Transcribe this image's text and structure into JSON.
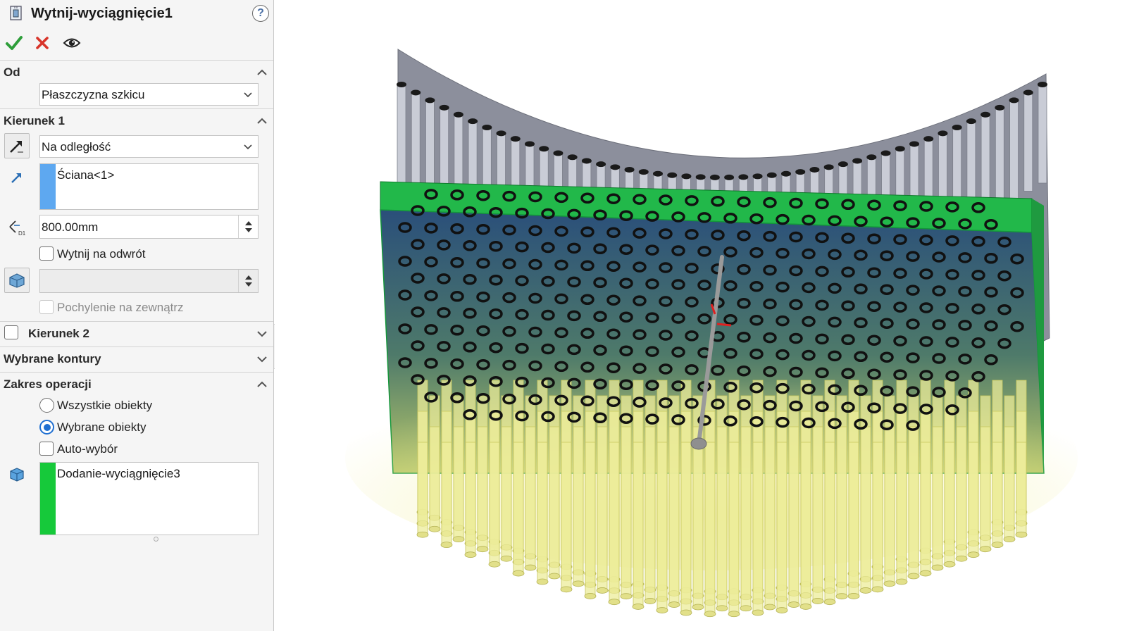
{
  "panel": {
    "title": "Wytnij-wyciągnięcie1",
    "help_label": "?",
    "actions": {
      "ok_icon": "checkmark-icon",
      "cancel_icon": "close-icon",
      "preview_icon": "eye-icon"
    },
    "od": {
      "title": "Od",
      "start_condition": "Płaszczyzna szkicu"
    },
    "kierunek1": {
      "title": "Kierunek 1",
      "end_condition": "Na odległość",
      "direction_selection": "Ściana<1>",
      "depth": "800.00mm",
      "flip_side_label": "Wytnij na odwrót",
      "draft_value": "",
      "draft_outward_label": "Pochylenie na zewnątrz"
    },
    "kierunek2": {
      "title": "Kierunek 2"
    },
    "wybrane_kontury": {
      "title": "Wybrane kontury"
    },
    "zakres": {
      "title": "Zakres operacji",
      "option_all": "Wszystkie obiekty",
      "option_selected": "Wybrane obiekty",
      "auto_select_label": "Auto-wybór",
      "selected_body": "Dodanie-wyciągnięcie3"
    }
  },
  "colors": {
    "ok_green": "#2e9e3a",
    "cancel_red": "#d8342a",
    "selection_blue": "#5ea8f0",
    "selection_green": "#16c93a",
    "radio_blue": "#1f6fd1",
    "plate_green": "#22b84a",
    "plate_blue": "#2a5a86",
    "cylinder_yellow": "#e8e89a",
    "surface_gray": "#8c8f9c"
  }
}
